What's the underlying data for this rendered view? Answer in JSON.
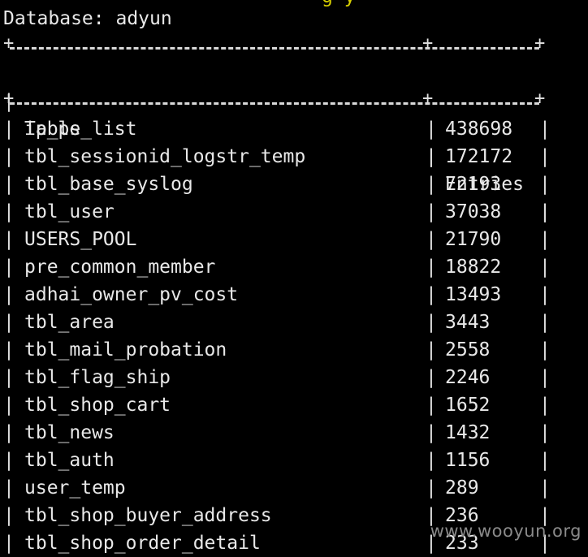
{
  "terminal": {
    "top_fragment": "g y",
    "database_line": "Database: adyun",
    "header": {
      "col_table": "Table",
      "col_entries": "Entries"
    },
    "rows": [
      {
        "table": "ip_ps_list",
        "entries": "438698"
      },
      {
        "table": "tbl_sessionid_logstr_temp",
        "entries": "172172"
      },
      {
        "table": "tbl_base_syslog",
        "entries": "72193"
      },
      {
        "table": "tbl_user",
        "entries": "37038"
      },
      {
        "table": "USERS_POOL",
        "entries": "21790"
      },
      {
        "table": "pre_common_member",
        "entries": "18822"
      },
      {
        "table": "adhai_owner_pv_cost",
        "entries": "13493"
      },
      {
        "table": "tbl_area",
        "entries": "3443"
      },
      {
        "table": "tbl_mail_probation",
        "entries": "2558"
      },
      {
        "table": "tbl_flag_ship",
        "entries": "2246"
      },
      {
        "table": "tbl_shop_cart",
        "entries": "1652"
      },
      {
        "table": "tbl_news",
        "entries": "1432"
      },
      {
        "table": "tbl_auth",
        "entries": "1156"
      },
      {
        "table": "user_temp",
        "entries": "289"
      },
      {
        "table": "tbl_shop_buyer_address",
        "entries": "236"
      },
      {
        "table": "tbl_shop_order_detail",
        "entries": "233"
      }
    ],
    "watermark": "www.wooyun.org"
  }
}
